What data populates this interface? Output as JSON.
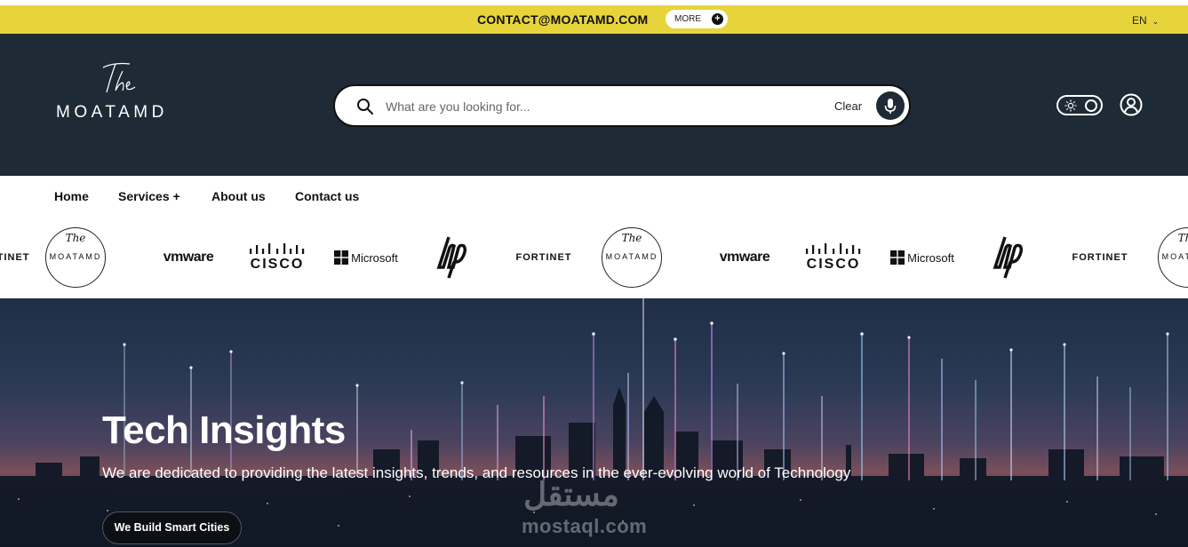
{
  "topbar": {
    "email": "CONTACT@MOATAMD.COM",
    "more_label": "MORE",
    "more_icon": "plus-circle-icon",
    "language": "EN",
    "colors": {
      "background": "#e6d43a"
    }
  },
  "header": {
    "logo_script": "The",
    "logo_text": "MOATAMD",
    "search": {
      "placeholder": "What are you looking for...",
      "clear_label": "Clear",
      "icon": "search-icon",
      "mic_icon": "microphone-icon"
    },
    "theme_toggle_icon": "sun-icon",
    "user_icon": "user-icon",
    "colors": {
      "background": "#1e2a36"
    }
  },
  "nav": {
    "items": [
      {
        "label": "Home"
      },
      {
        "label": "Services +"
      },
      {
        "label": "About us"
      },
      {
        "label": "Contact us"
      }
    ]
  },
  "partners": {
    "logos": [
      "FORTINET",
      "MOATAMD",
      "vmware",
      "CISCO",
      "Microsoft",
      "hp",
      "FORTINET",
      "MOATAMD",
      "vmware",
      "CISCO",
      "Microsoft",
      "hp",
      "FORTINET",
      "MOATAMD"
    ]
  },
  "hero": {
    "title": "Tech Insights",
    "subtitle": "We are dedicated to providing the latest insights, trends, and resources in the ever-evolving world of Technology",
    "cta_label": "We Build Smart Cities",
    "watermark_text": "mostaql.com",
    "watermark_arabic": "مستقل"
  }
}
